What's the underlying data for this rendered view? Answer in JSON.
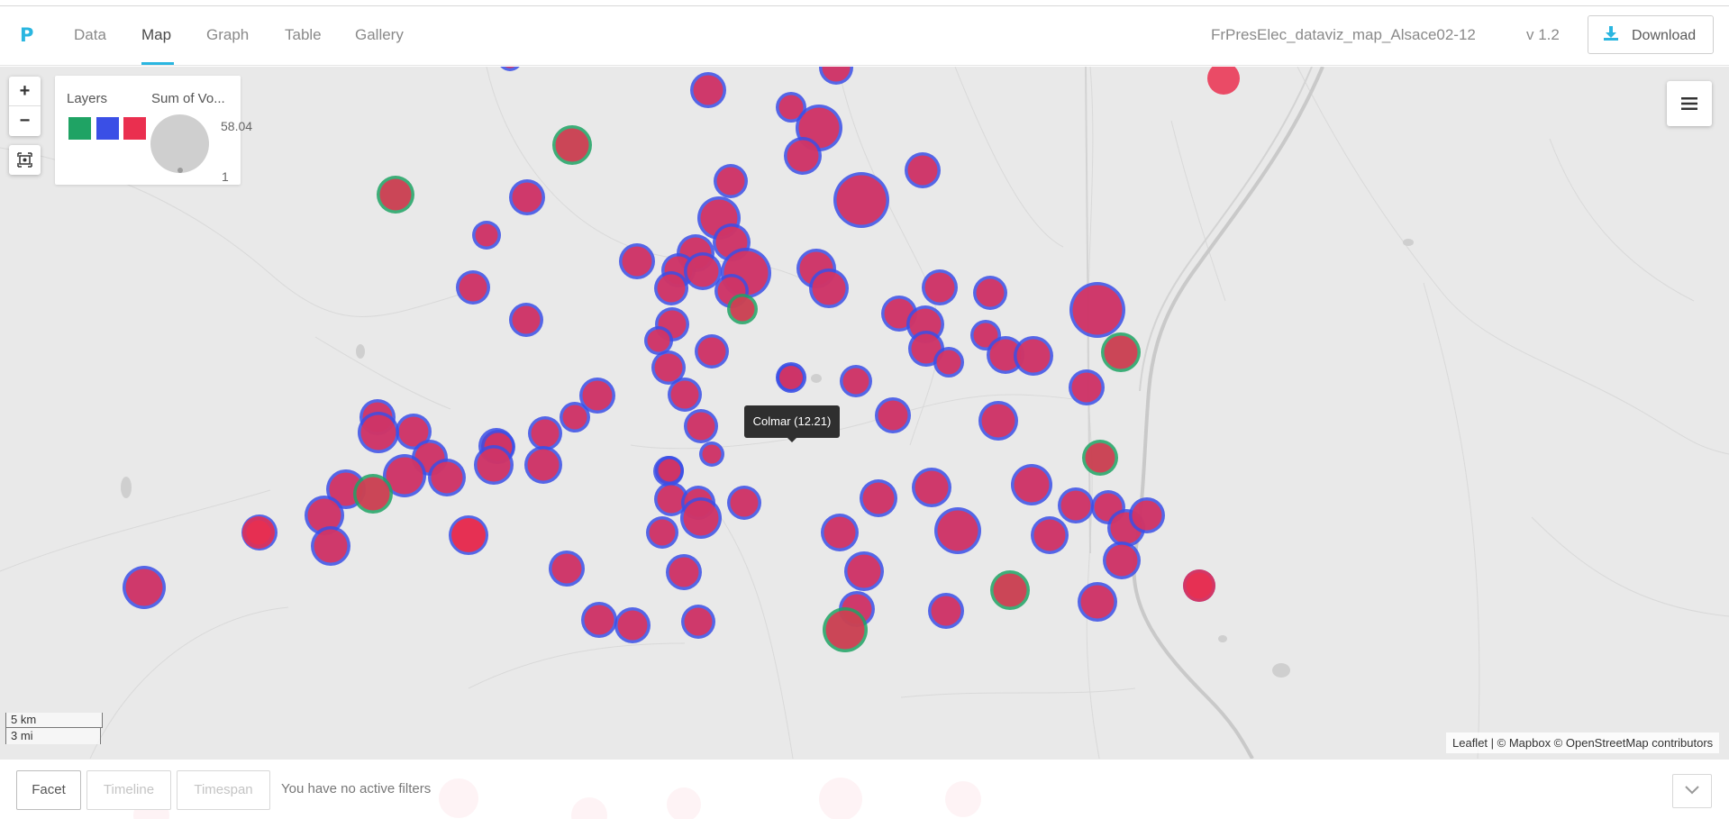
{
  "app": {
    "logo": "P",
    "file_title": "FrPresElec_dataviz_map_Alsace02-12",
    "version": "v 1.2",
    "download_label": "Download"
  },
  "nav": {
    "tabs": [
      {
        "label": "Data",
        "active": false
      },
      {
        "label": "Map",
        "active": true
      },
      {
        "label": "Graph",
        "active": false
      },
      {
        "label": "Table",
        "active": false
      },
      {
        "label": "Gallery",
        "active": false
      }
    ]
  },
  "map": {
    "zoom_in": "+",
    "zoom_out": "−",
    "legend": {
      "layers_title": "Layers",
      "size_title": "Sum of Vo...",
      "layer_colors": [
        "#1fa364",
        "#3a4fe6",
        "#ea2f4f"
      ],
      "size_max": "58.04",
      "size_min": "1"
    },
    "tooltip": "Colmar (12.21)",
    "scale_km": "5 km",
    "scale_mi": "3 mi",
    "attribution": "Leaflet | © Mapbox © OpenStreetMap contributors"
  },
  "filters": {
    "facet_label": "Facet",
    "timeline_label": "Timeline",
    "timespan_label": "Timespan",
    "status": "You have no active filters"
  },
  "colors": {
    "accent": "#2ab6e0",
    "map_background": "#e9e9e9",
    "marker_green": "#1fa364",
    "marker_blue": "#3a4fe6",
    "marker_red": "#ea2f4f"
  }
}
